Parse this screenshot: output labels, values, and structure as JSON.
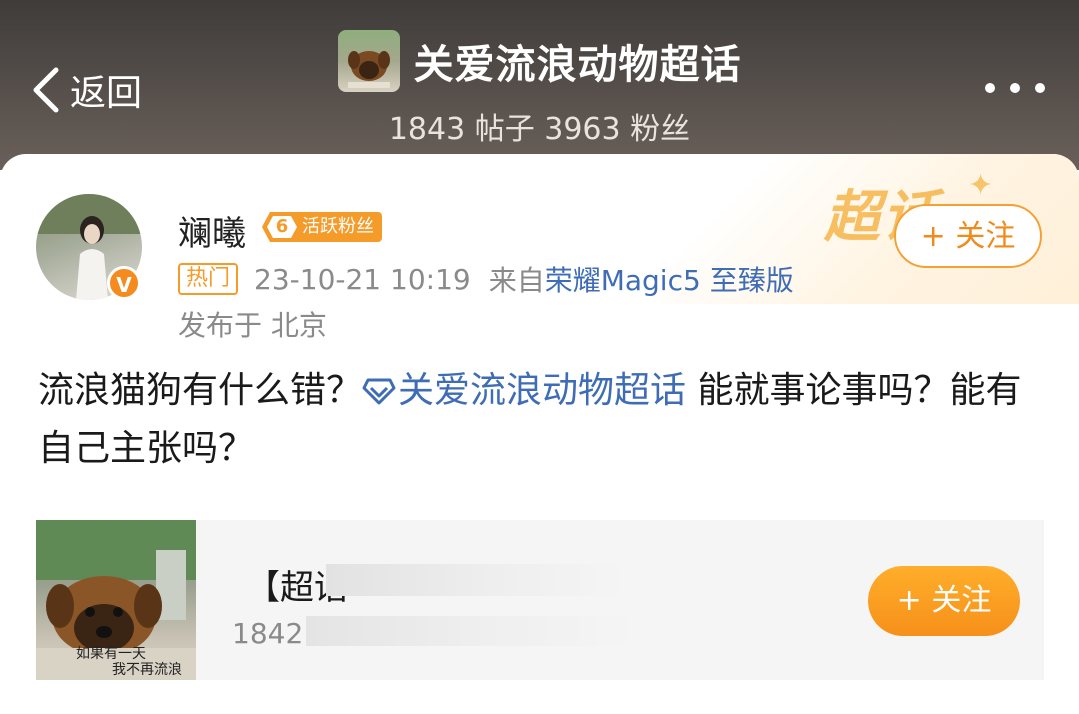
{
  "header": {
    "back_label": "返回",
    "topic_title": "关爱流浪动物超话",
    "topic_stats": "1843 帖子 3963 粉丝"
  },
  "post": {
    "username": "斓曦",
    "fan_level": "6",
    "fan_badge": "活跃粉丝",
    "hot_tag": "热门",
    "timestamp": "23-10-21 10:19",
    "source_prefix": "来自",
    "source": "荣耀Magic5 至臻版",
    "location": "发布于 北京",
    "follow_label": "+ 关注",
    "deco_text": "超话",
    "text_before": "流浪猫狗有什么错？",
    "topic_link": "关爱流浪动物超话",
    "text_after": " 能就事论事吗？能有自己主张吗？"
  },
  "share_card": {
    "title": "【超话",
    "stats": "1842 帖",
    "follow_label": "+ 关注",
    "thumb_caption_line1": "如果有一天",
    "thumb_caption_line2": "我不再流浪"
  },
  "colors": {
    "accent_orange": "#f59b2a",
    "link_blue": "#3f6db5"
  }
}
